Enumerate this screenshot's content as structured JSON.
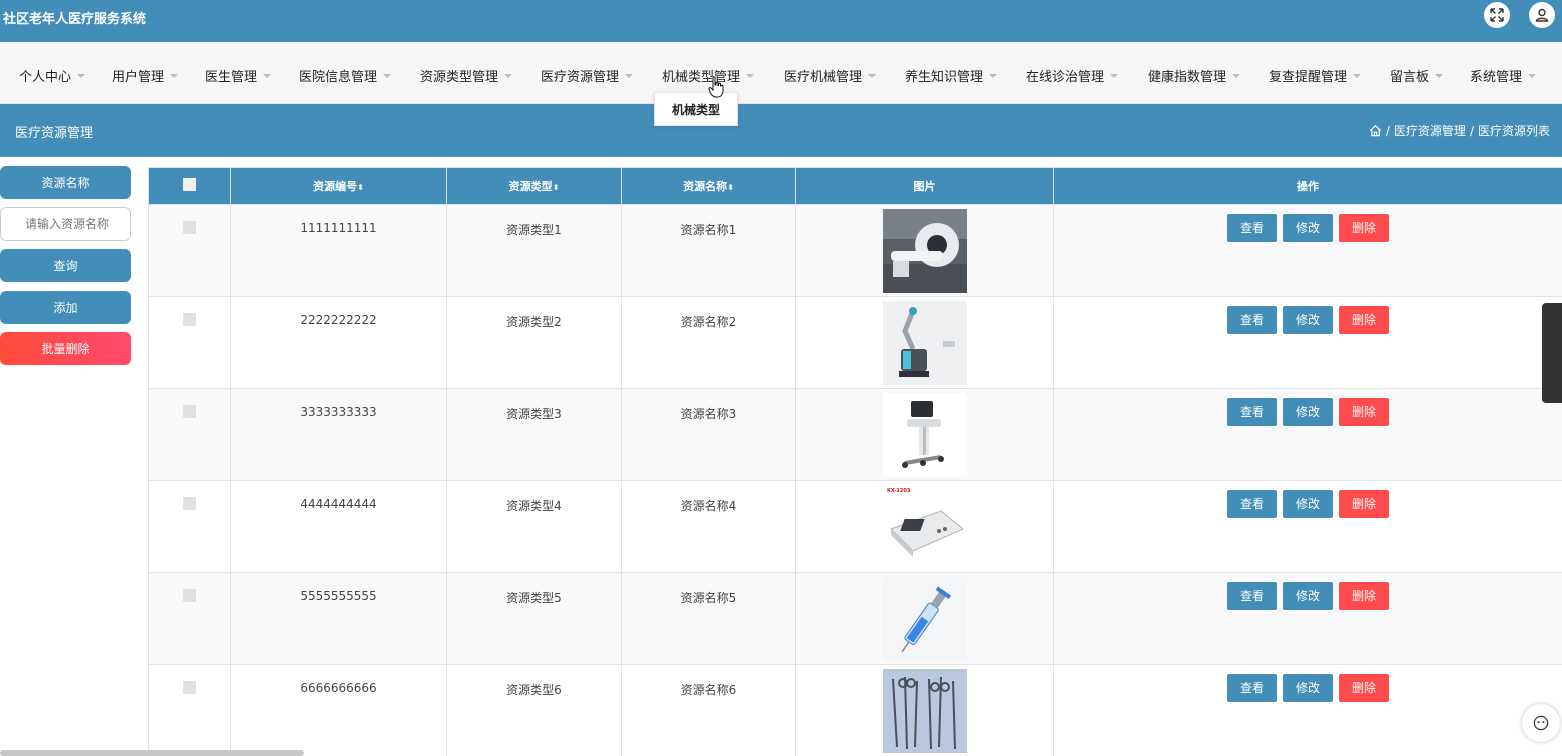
{
  "app": {
    "title": "社区老年人医疗服务系统"
  },
  "topbar": {
    "fullscreen_icon": "fullscreen-icon",
    "user_icon": "user-icon"
  },
  "nav": {
    "items": [
      {
        "label": "个人中心"
      },
      {
        "label": "用户管理"
      },
      {
        "label": "医生管理"
      },
      {
        "label": "医院信息管理"
      },
      {
        "label": "资源类型管理"
      },
      {
        "label": "医疗资源管理"
      },
      {
        "label": "机械类型管理"
      },
      {
        "label": "医疗机械管理"
      },
      {
        "label": "养生知识管理"
      },
      {
        "label": "在线诊治管理"
      },
      {
        "label": "健康指数管理"
      },
      {
        "label": "复查提醒管理"
      },
      {
        "label": "留言板"
      },
      {
        "label": "系统管理"
      }
    ],
    "dropdown": {
      "label": "机械类型"
    }
  },
  "section": {
    "title": "医疗资源管理",
    "breadcrumb": {
      "level1": "医疗资源管理",
      "level2": "医疗资源列表",
      "separator": "/"
    }
  },
  "search": {
    "field_label": "资源名称",
    "placeholder": "请输入资源名称",
    "query_button": "查询",
    "add_button": "添加",
    "batch_delete_button": "批量删除"
  },
  "table": {
    "columns": {
      "code": "资源编号",
      "type": "资源类型",
      "name": "资源名称",
      "image": "图片",
      "actions": "操作",
      "sort_indicator": "⬍"
    },
    "actions": {
      "view": "查看",
      "edit": "修改",
      "delete": "删除"
    },
    "rows": [
      {
        "code": "1111111111",
        "type": "资源类型1",
        "name": "资源名称1",
        "image": "ct-scanner"
      },
      {
        "code": "2222222222",
        "type": "资源类型2",
        "name": "资源名称2",
        "image": "medical-robot-arm"
      },
      {
        "code": "3333333333",
        "type": "资源类型3",
        "name": "资源名称3",
        "image": "ultrasound-cart"
      },
      {
        "code": "4444444444",
        "type": "资源类型4",
        "name": "资源名称4",
        "image": "ecg-machine"
      },
      {
        "code": "5555555555",
        "type": "资源类型5",
        "name": "资源名称5",
        "image": "syringe"
      },
      {
        "code": "6666666666",
        "type": "资源类型6",
        "name": "资源名称6",
        "image": "surgical-instruments"
      }
    ]
  },
  "colors": {
    "primary": "#438eb9",
    "danger": "#ff4b4b",
    "nav_bg": "#f6f6f8"
  },
  "thumb_labels": {
    "ecg": "KX-1203"
  }
}
